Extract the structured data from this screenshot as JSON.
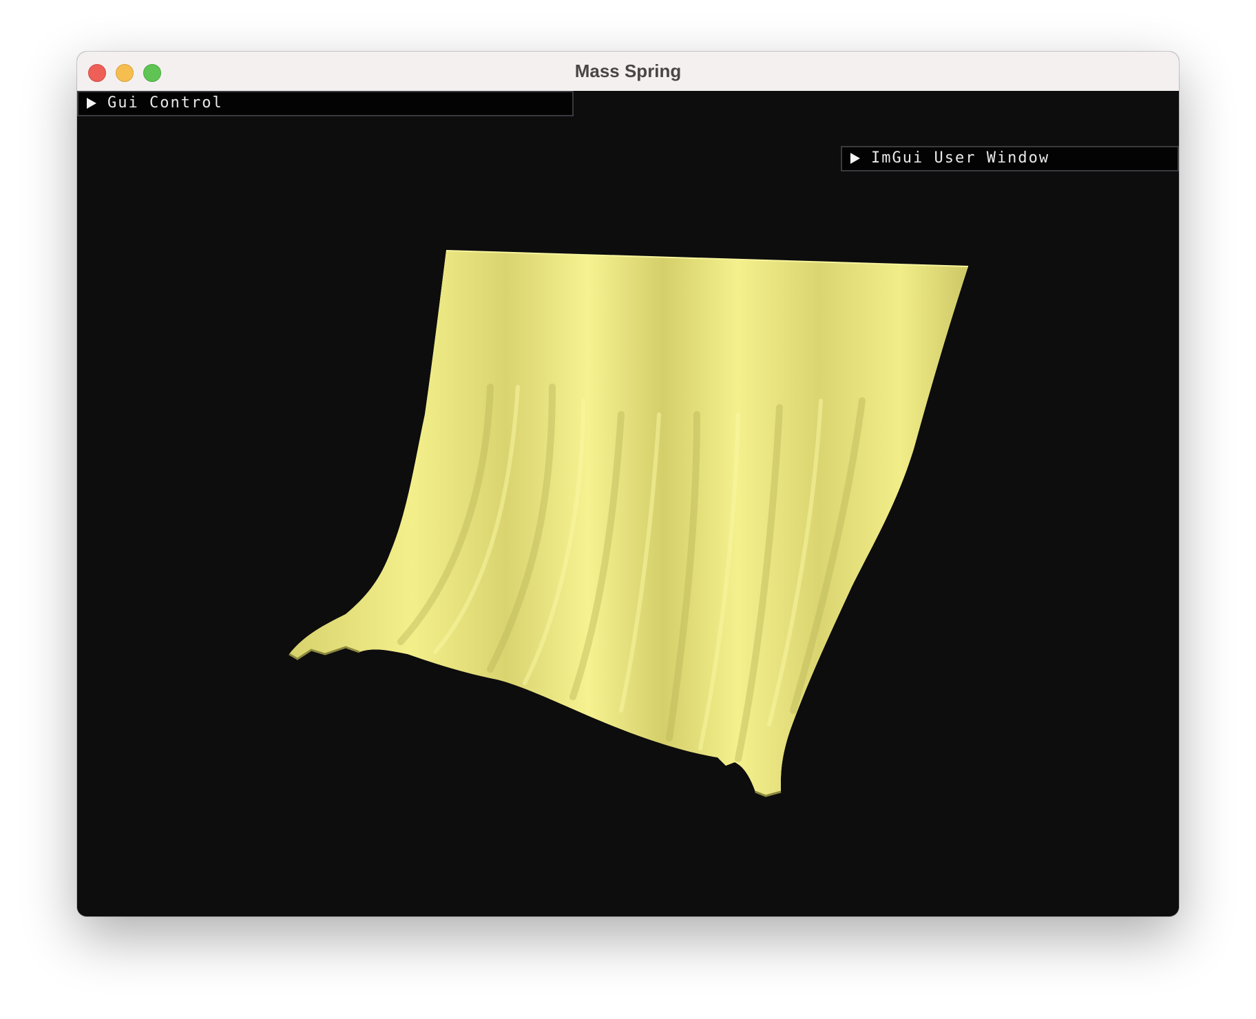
{
  "window": {
    "title": "Mass Spring",
    "controls": {
      "close": "close-button",
      "minimize": "minimize-button",
      "maximize": "maximize-button"
    }
  },
  "imgui": {
    "gui_control": {
      "label": "Gui Control",
      "icon": "triangle-right-icon",
      "collapsed": true
    },
    "user_window": {
      "label": "ImGui User Window",
      "icon": "triangle-right-icon",
      "collapsed": true
    }
  },
  "scene": {
    "object": "cloth-mesh",
    "colors": {
      "background": "#0d0d0e",
      "cloth_light": "#f6f38e",
      "cloth_mid": "#e8e37a",
      "cloth_shadow": "#c9c462",
      "wire": "#2b2a12"
    }
  }
}
